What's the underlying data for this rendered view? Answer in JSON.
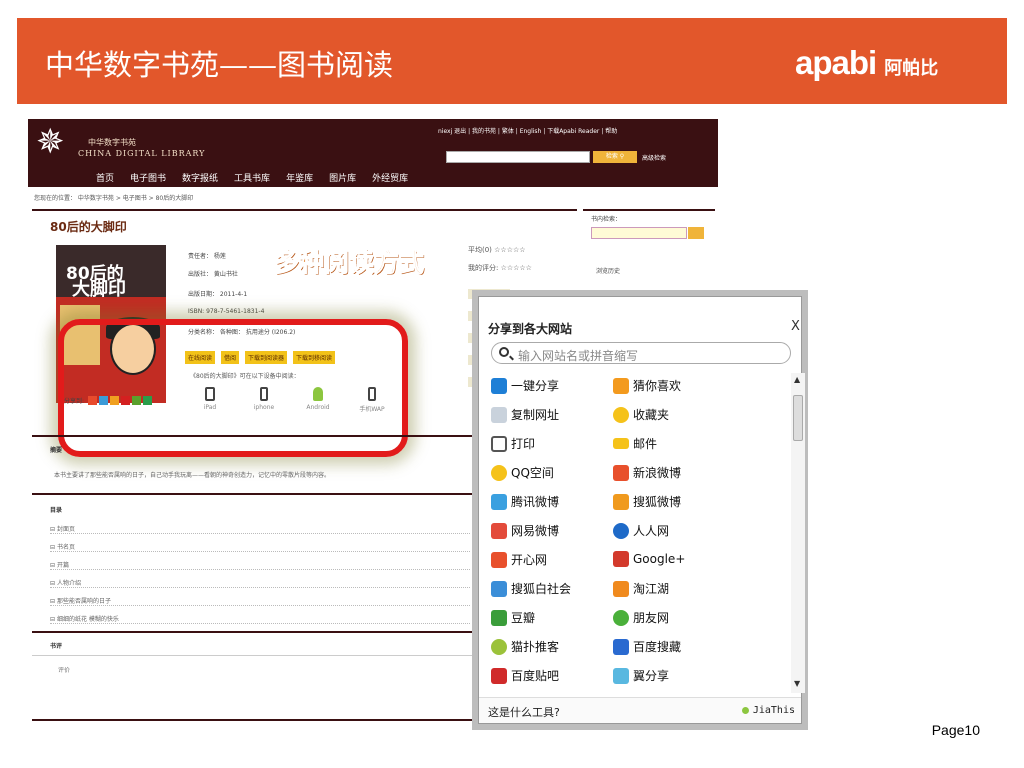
{
  "slide": {
    "title": "中华数字书苑——图书阅读",
    "brand_en": "apabi",
    "brand_cn": "阿帕比",
    "page": "Page10"
  },
  "site": {
    "logo_cn": "中华数字书苑",
    "logo_en": "CHINA DIGITAL LIBRARY",
    "top_links": "niexj 退出 | 我的书苑 | 繁体 | English | 下载Apabi Reader | 帮助",
    "search_button": "检索",
    "advanced_search": "高级检索",
    "nav": [
      "首页",
      "电子图书",
      "数字报纸",
      "工具书库",
      "年鉴库",
      "图片库",
      "外经贸库"
    ],
    "breadcrumb": "您现在的位置： 中华数字书苑 > 电子图书 > 80后的大脚印"
  },
  "book": {
    "title": "80后的大脚印",
    "cover_line1": "80后的",
    "cover_line2": "大脚印",
    "author": "责任者： 杨莲",
    "publisher": "出版社： 黄山书社",
    "pub_date": "出版日期： 2011-4-1",
    "isbn": "ISBN: 978-7-5461-1831-4",
    "category": "分类名称： 各种图： 抗用途分    (I206.2)",
    "callout": "多种阅读方式",
    "rating_avg": "平均(0) ☆☆☆☆☆",
    "rating_mine": "我的评分: ☆☆☆☆☆",
    "actions": [
      "在线阅读",
      "借阅",
      "下载到阅读器",
      "下载到移阅读"
    ],
    "read_note": "《80后的大脚印》可在以下设备中阅读：",
    "share_label": "分享到:",
    "devices": [
      "iPad",
      "iphone",
      "Android",
      "手机WAP"
    ]
  },
  "sidebar": {
    "in_book_search": "书内检索：",
    "history": "浏览历史"
  },
  "sections": {
    "summary_head": "摘要",
    "summary_text": "本书主要讲了那些能否属响的日子，自己动手我玩离——看朝的神奇创造力，记忆中的零散片段等内容。",
    "toc_head": "目录",
    "toc": [
      "封面页",
      "书名页",
      "开篇",
      "人物介绍",
      "那些能否属响的日子",
      "细细的纸花 模糊的快乐"
    ],
    "review_head": "书评",
    "review_item": "评价"
  },
  "share_popup": {
    "title": "分享到各大网站",
    "close": "X",
    "search_placeholder": "输入网站名或拼音缩写",
    "services_left": [
      "一键分享",
      "复制网址",
      "打印",
      "QQ空间",
      "腾讯微博",
      "网易微博",
      "开心网",
      "搜狐白社会",
      "豆瓣",
      "猫扑推客",
      "百度贴吧"
    ],
    "services_right": [
      "猜你喜欢",
      "收藏夹",
      "邮件",
      "新浪微博",
      "搜狐微博",
      "人人网",
      "Google+",
      "淘江湖",
      "朋友网",
      "百度搜藏",
      "翼分享"
    ],
    "help": "这是什么工具?",
    "brand": "JiaThis"
  }
}
